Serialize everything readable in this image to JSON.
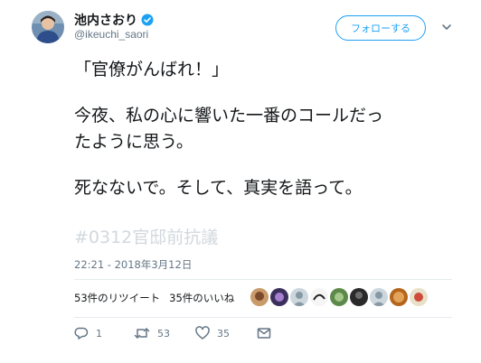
{
  "user": {
    "display_name": "池内さおり",
    "handle": "@ikeuchi_saori",
    "verified": true
  },
  "follow_button": {
    "label": "フォローする"
  },
  "tweet": {
    "lines": [
      "「官僚がんばれ！」",
      "今夜、私の心に響いた一番のコールだっ",
      "たように思う。",
      "死なないで。そして、真実を語って。"
    ],
    "hashtag": "#0312官邸前抗議",
    "timestamp": "22:21 - 2018年3月12日"
  },
  "stats": {
    "retweets": "53件のリツイート",
    "likes": "35件のいいね"
  },
  "actions": {
    "reply_count": "1",
    "retweet_count": "53",
    "like_count": "35"
  },
  "colors": {
    "accent": "#1da1f2",
    "muted": "#657786",
    "hashtag_faded": "#d1d8dd"
  }
}
